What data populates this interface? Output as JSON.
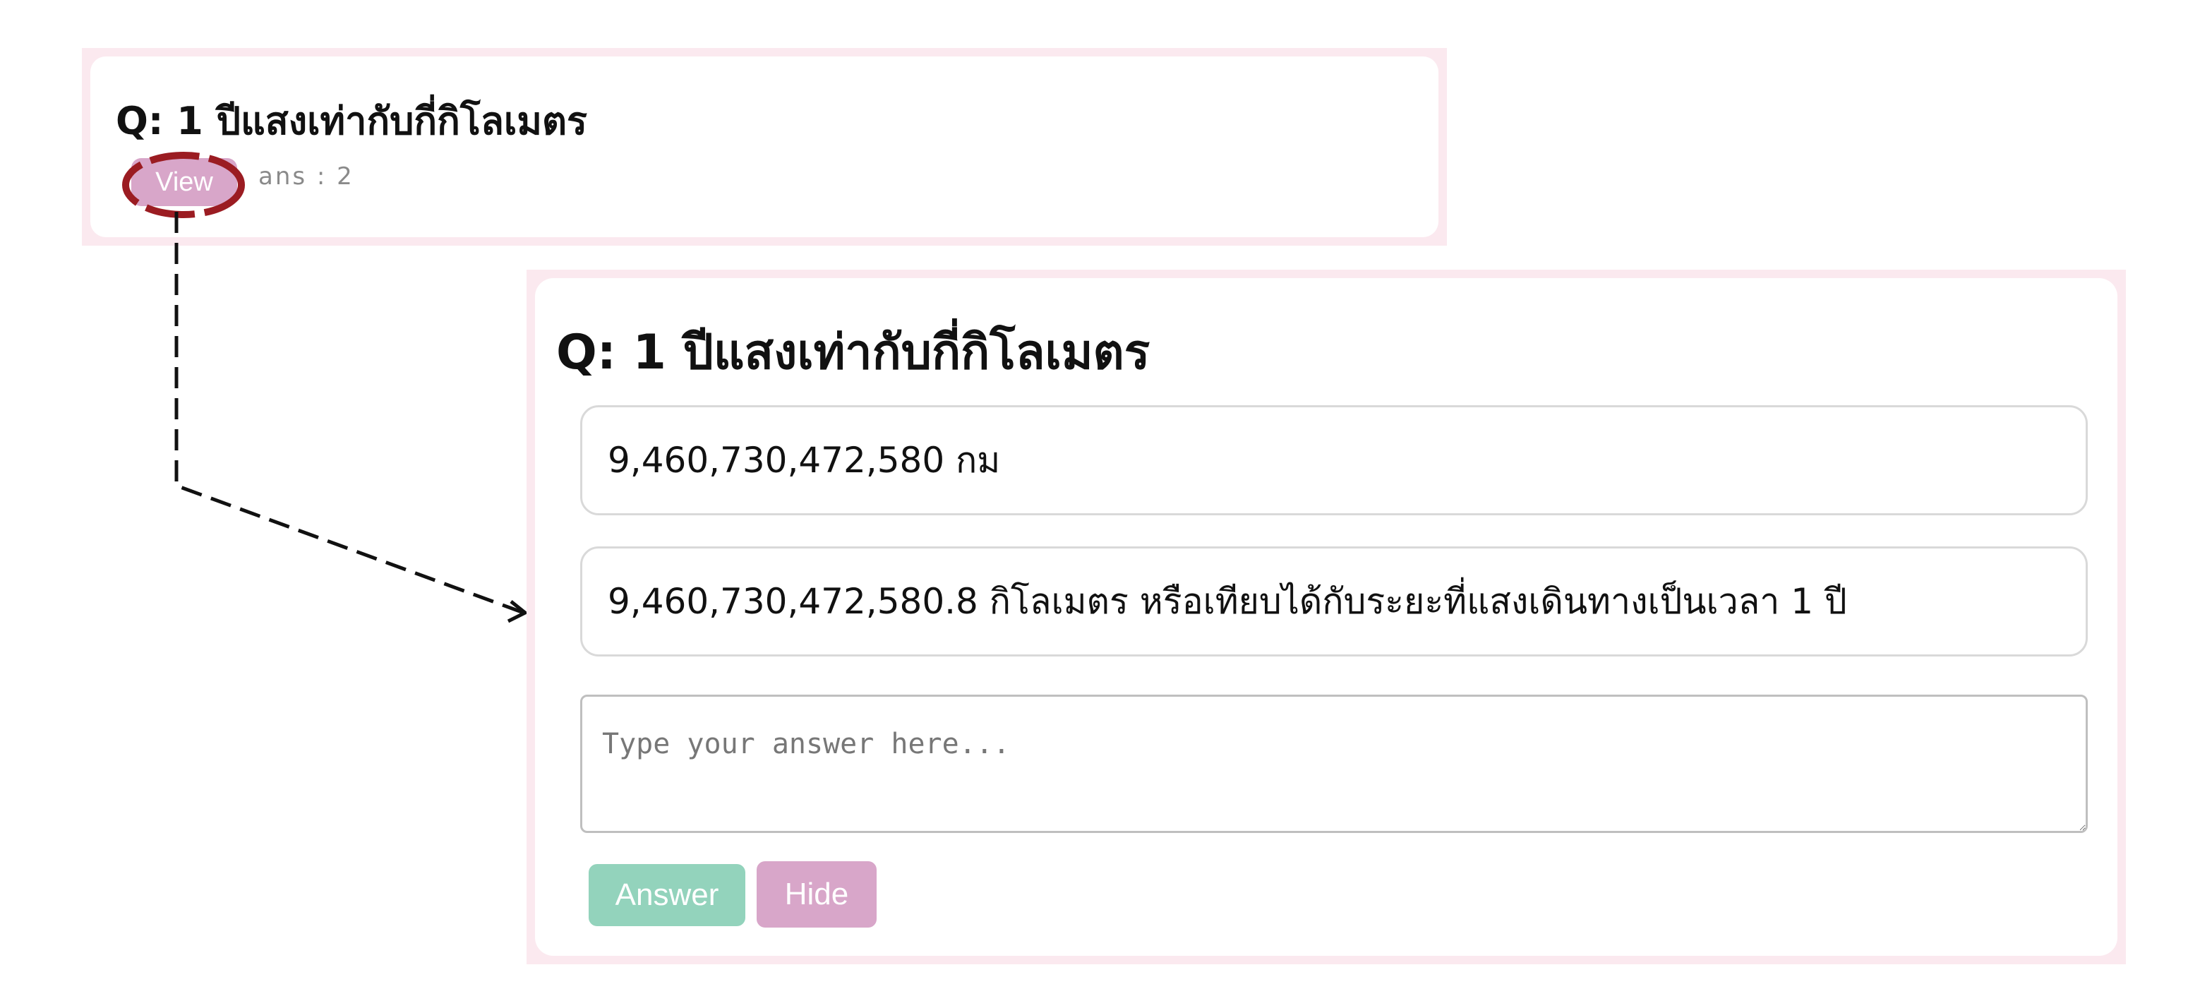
{
  "colors": {
    "card_border": "#fbe9ef",
    "view_button": "#d8a6c9",
    "highlight_ring": "#9b1c22",
    "answer_button": "#93d3bc",
    "hide_button": "#d8a6c9",
    "arrow": "#111111"
  },
  "small_card": {
    "question": "Q: 1 ปีแสงเท่ากับกี่กิโลเมตร",
    "view_label": "View",
    "ans_count": "ans : 2"
  },
  "large_card": {
    "question": "Q: 1 ปีแสงเท่ากับกี่กิโลเมตร",
    "answers": [
      {
        "text": "9,460,730,472,580 กม"
      },
      {
        "text": "9,460,730,472,580.8 กิโลเมตร หรือเทียบได้กับระยะที่แสงเดินทางเป็นเวลา 1 ปี"
      }
    ],
    "input": {
      "placeholder": "Type your answer here...",
      "value": ""
    },
    "answer_label": "Answer",
    "hide_label": "Hide"
  },
  "annotations": {
    "highlight": "dashed-ellipse-around-view-button",
    "arrow": "dashed-arrow-to-expanded-card"
  }
}
